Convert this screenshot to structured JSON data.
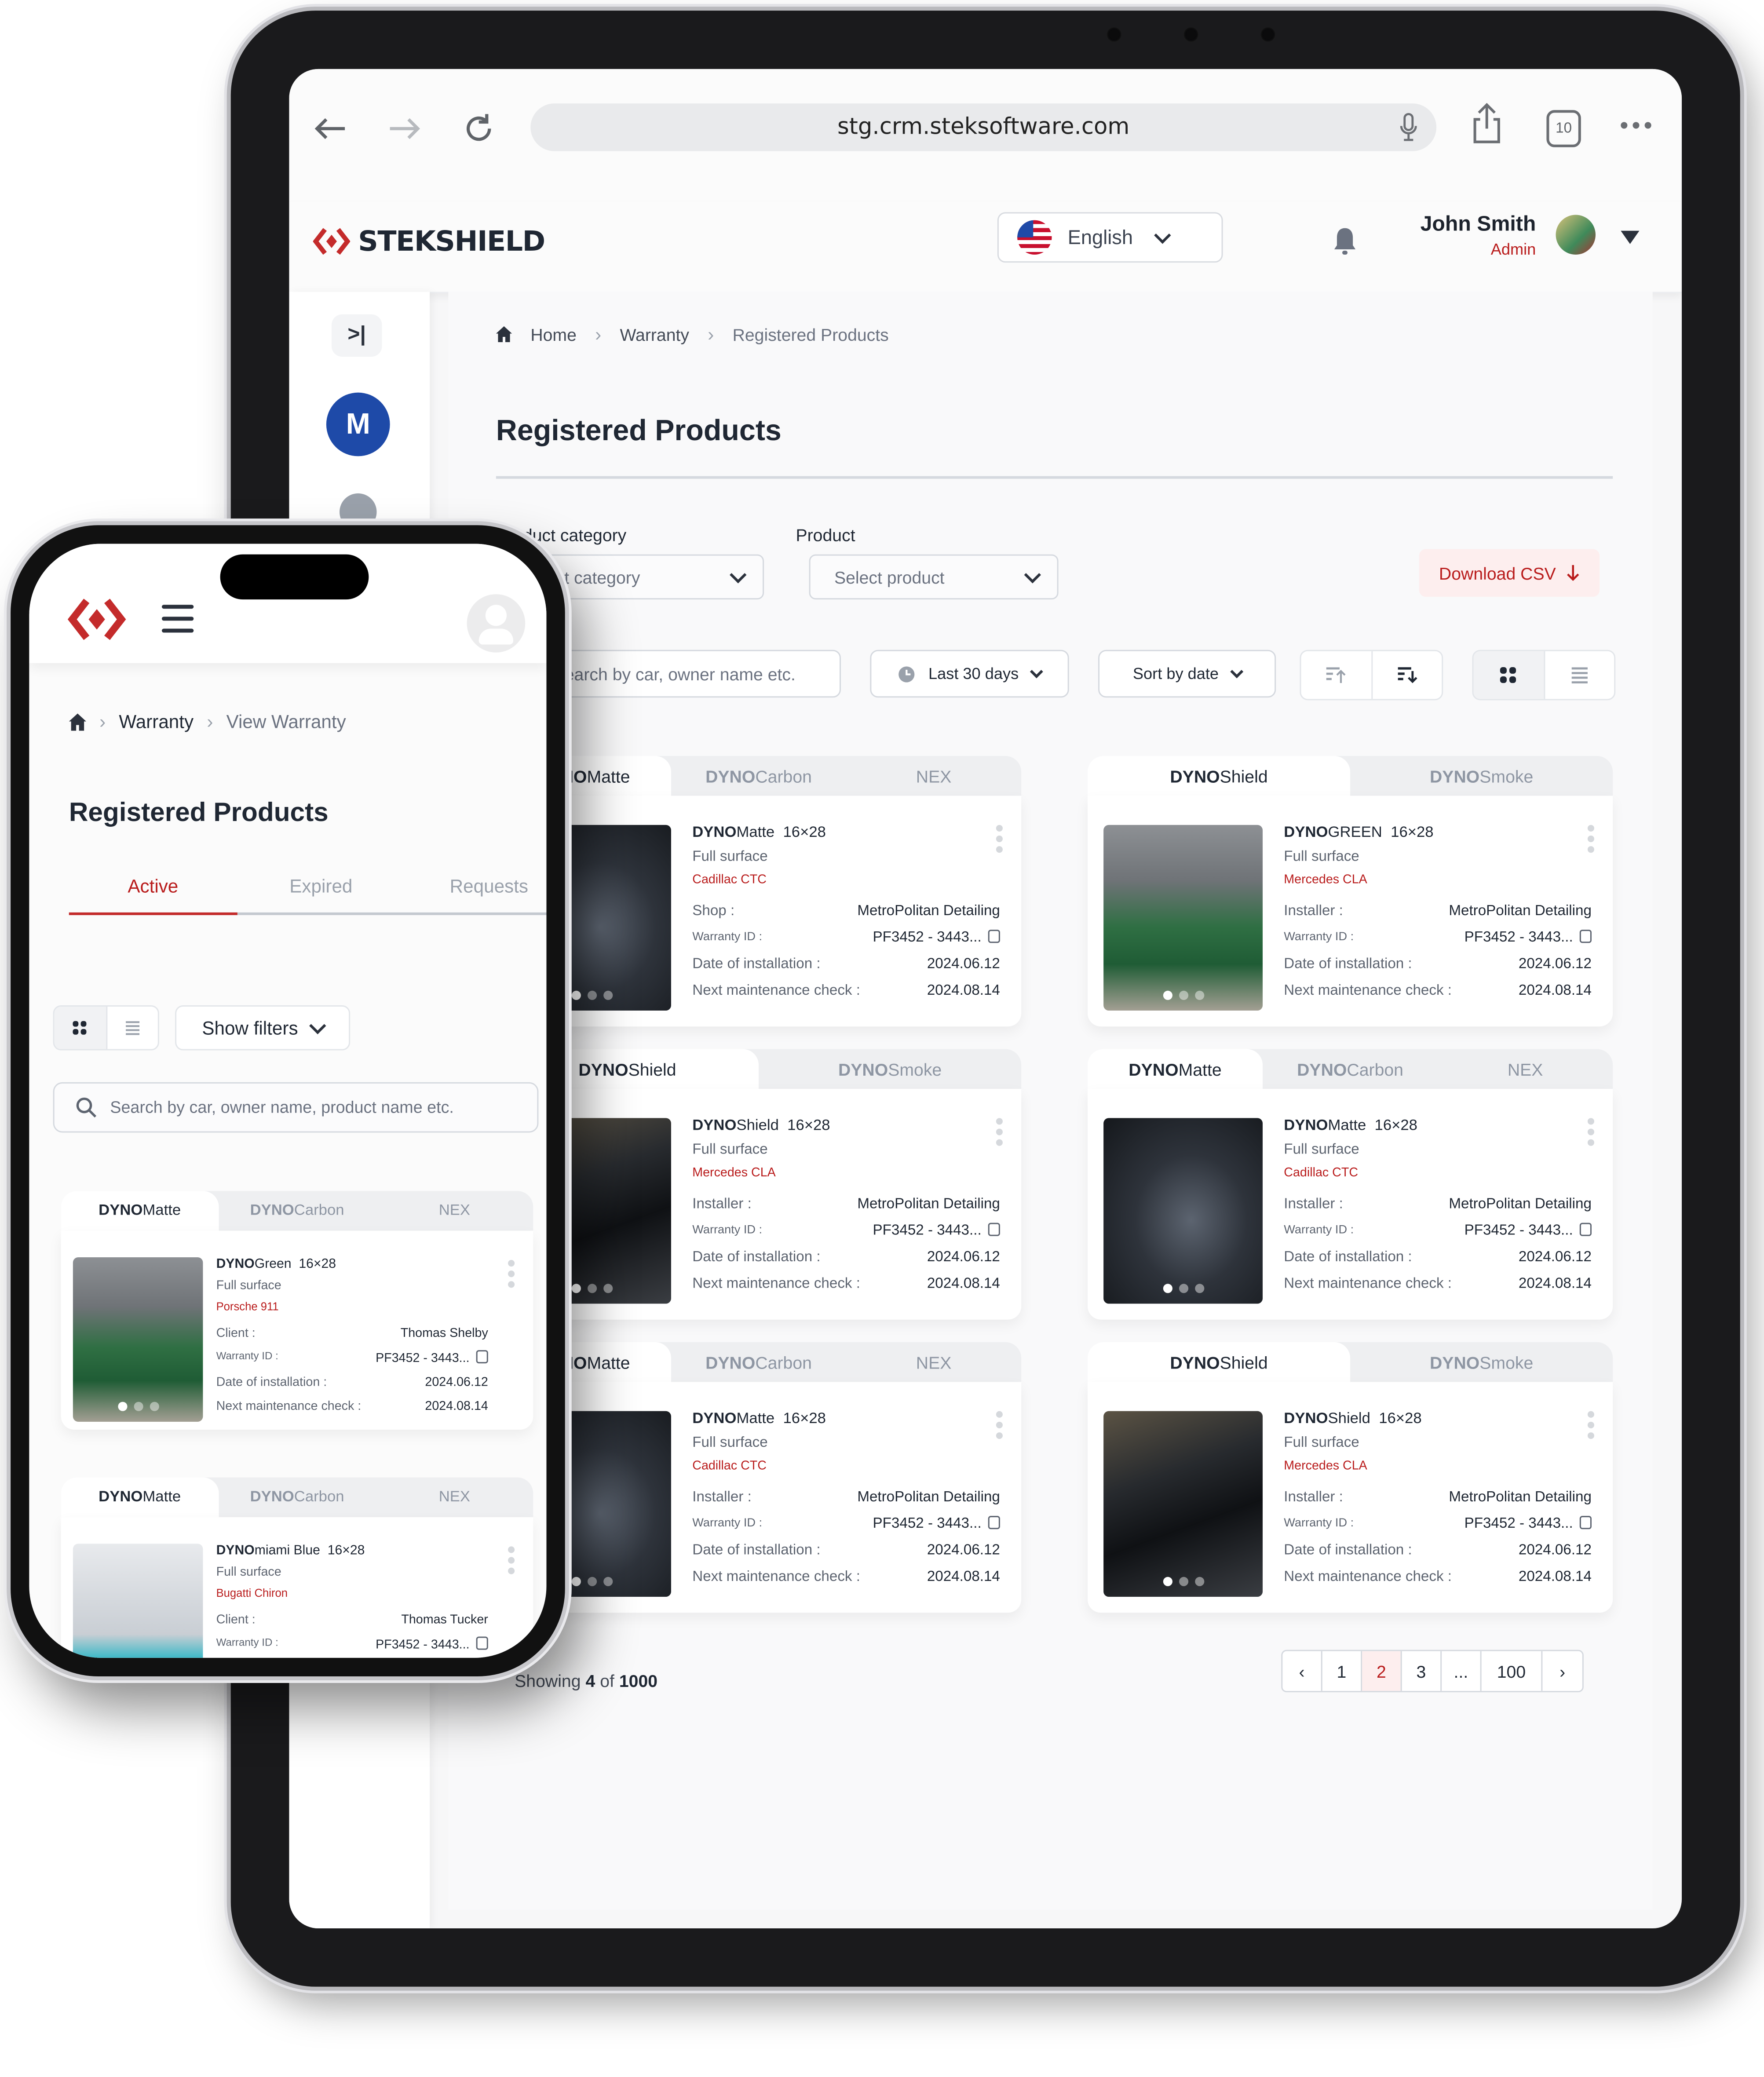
{
  "tablet": {
    "browser": {
      "url": "stg.crm.steksoftware.com",
      "tab_count": "10",
      "icons": [
        "back-arrow-icon",
        "forward-arrow-icon",
        "reload-icon",
        "microphone-icon",
        "share-icon",
        "tabs-icon",
        "more-icon"
      ]
    },
    "header": {
      "brand": "STEKSHIELD",
      "language": "English",
      "user_name": "John Smith",
      "user_role": "Admin"
    },
    "sidebar": {
      "collapse_label": ">|",
      "avatar_letter": "M"
    },
    "breadcrumb": [
      "Home",
      "Warranty",
      "Registered Products"
    ],
    "page_title": "Registered Products",
    "filters": {
      "category_label": "Product category",
      "category_placeholder": "Select category",
      "product_label": "Product",
      "product_placeholder": "Select product",
      "download_csv": "Download CSV",
      "search_placeholder": "Search by car, owner name etc.",
      "date_range": "Last 30 days",
      "sort": "Sort by date"
    },
    "cards": [
      {
        "tabs": [
          {
            "bold": "DYNO",
            "rest": "Matte",
            "active": true
          },
          {
            "bold": "DYNO",
            "rest": "Carbon",
            "active": false
          },
          {
            "bold": "",
            "rest": "NEX",
            "active": false
          }
        ],
        "product_bold": "DYNO",
        "product_rest": "Matte",
        "size": "16×28",
        "surface": "Full surface",
        "car": "Cadillac CTC",
        "k1": "Shop :",
        "v1": "MetroPolitan Detailing",
        "k2": "Warranty ID :",
        "v2": "PF3452 - 3443...",
        "k3": "Date of installation :",
        "v3": "2024.06.12",
        "k4": "Next maintenance check :",
        "v4": "2024.08.14"
      },
      {
        "tabs": [
          {
            "bold": "DYNO",
            "rest": "Shield",
            "active": true
          },
          {
            "bold": "DYNO",
            "rest": "Smoke",
            "active": false
          }
        ],
        "product_bold": "DYNO",
        "product_rest": "GREEN",
        "size": "16×28",
        "surface": "Full surface",
        "car": "Mercedes CLA",
        "k1": "Installer :",
        "v1": "MetroPolitan Detailing",
        "k2": "Warranty ID :",
        "v2": "PF3452 - 3443...",
        "k3": "Date of installation :",
        "v3": "2024.06.12",
        "k4": "Next maintenance check :",
        "v4": "2024.08.14"
      },
      {
        "tabs": [
          {
            "bold": "DYNO",
            "rest": "Shield",
            "active": true
          },
          {
            "bold": "DYNO",
            "rest": "Smoke",
            "active": false
          }
        ],
        "product_bold": "DYNO",
        "product_rest": "Shield",
        "size": "16×28",
        "surface": "Full surface",
        "car": "Mercedes CLA",
        "k1": "Installer :",
        "v1": "MetroPolitan Detailing",
        "k2": "Warranty ID :",
        "v2": "PF3452 - 3443...",
        "k3": "Date of installation :",
        "v3": "2024.06.12",
        "k4": "Next maintenance check :",
        "v4": "2024.08.14"
      },
      {
        "tabs": [
          {
            "bold": "DYNO",
            "rest": "Matte",
            "active": true
          },
          {
            "bold": "DYNO",
            "rest": "Carbon",
            "active": false
          },
          {
            "bold": "",
            "rest": "NEX",
            "active": false
          }
        ],
        "product_bold": "DYNO",
        "product_rest": "Matte",
        "size": "16×28",
        "surface": "Full surface",
        "car": "Cadillac CTC",
        "k1": "Installer :",
        "v1": "MetroPolitan Detailing",
        "k2": "Warranty ID :",
        "v2": "PF3452 - 3443...",
        "k3": "Date of installation :",
        "v3": "2024.06.12",
        "k4": "Next maintenance check :",
        "v4": "2024.08.14"
      },
      {
        "tabs": [
          {
            "bold": "DYNO",
            "rest": "Matte",
            "active": true
          },
          {
            "bold": "DYNO",
            "rest": "Carbon",
            "active": false
          },
          {
            "bold": "",
            "rest": "NEX",
            "active": false
          }
        ],
        "product_bold": "DYNO",
        "product_rest": "Matte",
        "size": "16×28",
        "surface": "Full surface",
        "car": "Cadillac CTC",
        "k1": "Installer :",
        "v1": "MetroPolitan Detailing",
        "k2": "Warranty ID :",
        "v2": "PF3452 - 3443...",
        "k3": "Date of installation :",
        "v3": "2024.06.12",
        "k4": "Next maintenance check :",
        "v4": "2024.08.14"
      },
      {
        "tabs": [
          {
            "bold": "DYNO",
            "rest": "Shield",
            "active": true
          },
          {
            "bold": "DYNO",
            "rest": "Smoke",
            "active": false
          }
        ],
        "product_bold": "DYNO",
        "product_rest": "Shield",
        "size": "16×28",
        "surface": "Full surface",
        "car": "Mercedes CLA",
        "k1": "Installer :",
        "v1": "MetroPolitan Detailing",
        "k2": "Warranty ID :",
        "v2": "PF3452 - 3443...",
        "k3": "Date of installation :",
        "v3": "2024.06.12",
        "k4": "Next maintenance check :",
        "v4": "2024.08.14"
      }
    ],
    "pagination": {
      "showing_prefix": "Showing",
      "showing_count": "4",
      "showing_of": "of",
      "showing_total": "1000",
      "pages": [
        "1",
        "2",
        "3",
        "...",
        "100"
      ],
      "current_page": "2"
    }
  },
  "phone": {
    "breadcrumb": [
      "Warranty",
      "View Warranty"
    ],
    "page_title": "Registered Products",
    "tabs": [
      "Active",
      "Expired",
      "Requests"
    ],
    "active_tab": "Active",
    "show_filters": "Show filters",
    "search_placeholder": "Search by car, owner name, product name etc.",
    "cards": [
      {
        "tabs": [
          {
            "bold": "DYNO",
            "rest": "Matte",
            "active": true
          },
          {
            "bold": "DYNO",
            "rest": "Carbon",
            "active": false
          },
          {
            "bold": "",
            "rest": "NEX",
            "active": false
          }
        ],
        "product_bold": "DYNO",
        "product_rest": "Green",
        "size": "16×28",
        "surface": "Full surface",
        "car": "Porsche 911",
        "k1": "Client :",
        "v1": "Thomas Shelby",
        "k2": "Warranty ID :",
        "v2": "PF3452 - 3443...",
        "k3": "Date of installation :",
        "v3": "2024.06.12",
        "k4": "Next maintenance check :",
        "v4": "2024.08.14"
      },
      {
        "tabs": [
          {
            "bold": "DYNO",
            "rest": "Matte",
            "active": true
          },
          {
            "bold": "DYNO",
            "rest": "Carbon",
            "active": false
          },
          {
            "bold": "",
            "rest": "NEX",
            "active": false
          }
        ],
        "product_bold": "DYNO",
        "product_rest": "miami Blue",
        "size": "16×28",
        "surface": "Full surface",
        "car": "Bugatti Chiron",
        "k1": "Client :",
        "v1": "Thomas Tucker",
        "k2": "Warranty ID :",
        "v2": "PF3452 - 3443..."
      }
    ]
  },
  "colors": {
    "accent_red": "#b91c1c",
    "text_dark": "#1f2733",
    "avatar_blue": "#1e4aa8",
    "csv_bg": "#fdeeee"
  }
}
